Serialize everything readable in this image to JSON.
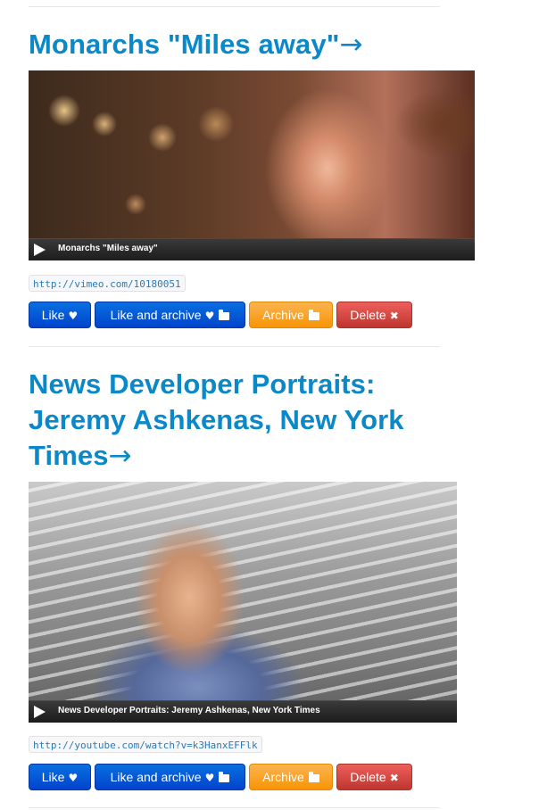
{
  "posts": [
    {
      "title": "Monarchs \"Miles away\"",
      "arrow": "→",
      "video_title": "Monarchs \"Miles away\"",
      "url": "http://vimeo.com/10180051",
      "buttons": {
        "like": "Like",
        "like_archive": "Like and archive",
        "archive": "Archive",
        "delete": "Delete"
      }
    },
    {
      "title_line1": "News Developer Portraits:",
      "title_line2": "Jeremy Ashkenas, New York",
      "title_line3": "Times",
      "arrow": "→",
      "video_title": "News Developer Portraits: Jeremy Ashkenas, New York Times",
      "url": "http://youtube.com/watch?v=k3HanxEFFlk",
      "buttons": {
        "like": "Like",
        "like_archive": "Like and archive",
        "archive": "Archive",
        "delete": "Delete"
      }
    }
  ],
  "icons": {
    "heart": "heart-icon",
    "folder": "folder-open-icon",
    "close": "close-icon",
    "play": "play-icon"
  },
  "colors": {
    "link": "#0a88c8",
    "primary": "#0044cc",
    "warning": "#f89406",
    "danger": "#bd362f"
  }
}
